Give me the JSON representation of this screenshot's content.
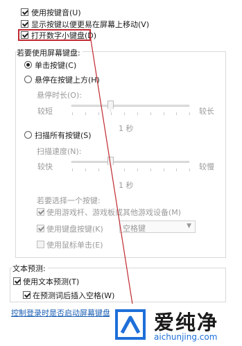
{
  "options": {
    "key_sound": "使用按键音(U)",
    "move_keys": "显示按键以便更易在屏幕上移动(V)",
    "numpad": "打开数字小键盘(D)"
  },
  "typing_mode": {
    "header": "若要使用屏幕键盘:",
    "click_keys": "单击按键(C)",
    "hover_keys": "悬停在按键上方(H)",
    "hover_duration_label": "悬停时长(O):",
    "hover_short": "较短",
    "hover_long": "较长",
    "hover_value": "1 秒",
    "scan_keys": "扫描所有按键(S)",
    "scan_speed_label": "扫描速度(N):",
    "scan_fast": "较快",
    "scan_slow": "较慢",
    "scan_value": "1 秒",
    "select_key_label": "若要选择一个按键:",
    "use_joystick": "使用游戏杆、游戏板或其他游戏设备(M)",
    "use_keyboard_key": "使用键盘按键(K)",
    "keyboard_key_value": "空格键",
    "use_mouse_click": "使用鼠标单击(E)"
  },
  "text_prediction": {
    "header": "文本预测:",
    "use_prediction": "使用文本预测(T)",
    "insert_space": "在预测词后插入空格(W)"
  },
  "login_link": "控制登录时是否启动屏幕键盘",
  "watermark": {
    "brand": "爱纯净",
    "url": "aichunjing.com"
  },
  "colors": {
    "highlight": "#c0282f",
    "link": "#1a5fb4",
    "logo_blue": "#1e6fd9"
  }
}
